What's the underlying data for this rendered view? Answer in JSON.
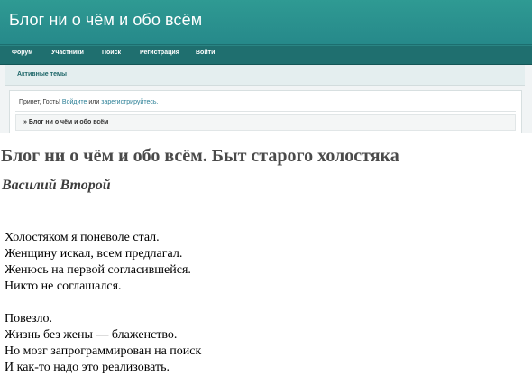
{
  "forum": {
    "title": "Блог ни о чём и обо всём",
    "nav": [
      "Форум",
      "Участники",
      "Поиск",
      "Регистрация",
      "Войти"
    ],
    "subbar_link": "Активные темы",
    "greeting": {
      "prefix": "Привет, Гость!",
      "login": "Войдите",
      "or": "или",
      "register": "зарегистрируйтесь."
    },
    "breadcrumb": "» Блог ни о чём и обо всём"
  },
  "article": {
    "title": "Блог ни о чём и обо всём. Быт старого холостяка",
    "author": "Василий Второй",
    "stanzas": [
      [
        "Холостяком я поневоле стал.",
        "Женщину искал, всем предлагал.",
        "Женюсь на первой согласившейся.",
        "Никто не соглашался."
      ],
      [
        "Повезло.",
        "Жизнь без жены — блаженство.",
        "Но мозг запрограммирован на поиск",
        "И как-то надо это реализовать."
      ]
    ]
  }
}
